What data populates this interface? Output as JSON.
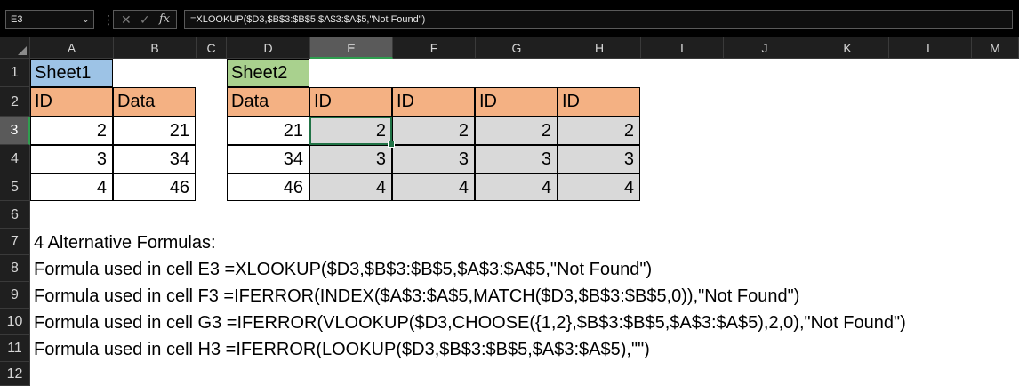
{
  "formula_bar": {
    "name_box": "E3",
    "formula": "=XLOOKUP($D3,$B$3:$B$5,$A$3:$A$5,\"Not Found\")",
    "cancel_icon": "close-icon",
    "enter_icon": "check-icon",
    "function_icon": "fx-icon",
    "fx_label": "fx"
  },
  "columns": [
    "A",
    "B",
    "C",
    "D",
    "E",
    "F",
    "G",
    "H",
    "I",
    "J",
    "K",
    "L",
    "M"
  ],
  "selected_column": "E",
  "rows": [
    "1",
    "2",
    "3",
    "4",
    "5",
    "6",
    "7",
    "8",
    "9",
    "10",
    "11",
    "12"
  ],
  "selected_row": "3",
  "sheet1": {
    "title": "Sheet1",
    "headers": [
      "ID",
      "Data"
    ],
    "rows": [
      [
        "2",
        "21"
      ],
      [
        "3",
        "34"
      ],
      [
        "4",
        "46"
      ]
    ]
  },
  "sheet2": {
    "title": "Sheet2",
    "headers": [
      "Data",
      "ID",
      "ID",
      "ID",
      "ID"
    ],
    "rows": [
      [
        "21",
        "2",
        "2",
        "2",
        "2"
      ],
      [
        "34",
        "3",
        "3",
        "3",
        "3"
      ],
      [
        "46",
        "4",
        "4",
        "4",
        "4"
      ]
    ]
  },
  "notes": {
    "heading": "4 Alternative Formulas:",
    "lines": [
      "Formula used in cell E3 =XLOOKUP($D3,$B$3:$B$5,$A$3:$A$5,\"Not Found\")",
      "Formula used in cell F3 =IFERROR(INDEX($A$3:$A$5,MATCH($D3,$B$3:$B$5,0)),\"Not Found\")",
      "Formula used in cell G3 =IFERROR(VLOOKUP($D3,CHOOSE({1,2},$B$3:$B$5,$A$3:$A$5),2,0),\"Not Found\")",
      "Formula used in cell H3 =IFERROR(LOOKUP($D3,$B$3:$B$5,$A$3:$A$5),\"\")"
    ]
  },
  "colors": {
    "sheet1_title_fill": "#9dc3e6",
    "sheet2_title_fill": "#a9d18e",
    "header_fill": "#f4b183",
    "result_fill": "#d9d9d9",
    "selection_accent": "#217346"
  }
}
